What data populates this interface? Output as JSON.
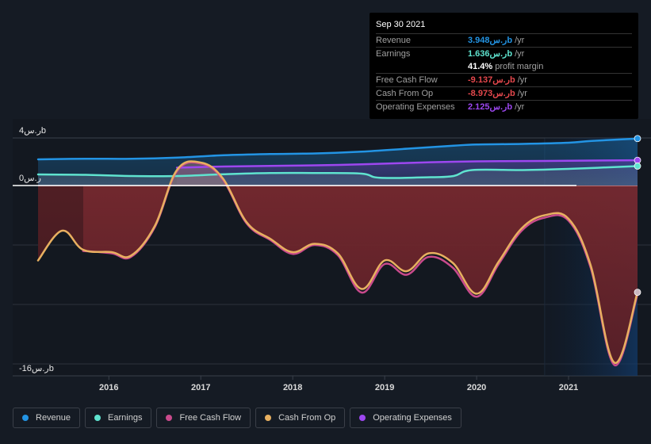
{
  "colors": {
    "revenue": "#2394e4",
    "earnings": "#5fe3cf",
    "fcf": "#c94a8c",
    "cfo": "#e8b060",
    "opex": "#9d47f0"
  },
  "tooltip": {
    "date": "Sep 30 2021",
    "rows": [
      {
        "label": "Revenue",
        "value": "3.948ر.سb",
        "unit": "/yr",
        "color": "#2394e4"
      },
      {
        "label": "Earnings",
        "value": "1.636ر.سb",
        "unit": "/yr",
        "color": "#5fe3cf"
      },
      {
        "label": "",
        "value": "41.4%",
        "unit": "profit margin",
        "color": "#ffffff"
      },
      {
        "label": "Free Cash Flow",
        "value": "-9.137ر.سb",
        "unit": "/yr",
        "color": "#e5484d"
      },
      {
        "label": "Cash From Op",
        "value": "-8.973ر.سb",
        "unit": "/yr",
        "color": "#e5484d"
      },
      {
        "label": "Operating Expenses",
        "value": "2.125ر.سb",
        "unit": "/yr",
        "color": "#9d47f0"
      }
    ]
  },
  "legend": [
    {
      "label": "Revenue",
      "color": "#2394e4"
    },
    {
      "label": "Earnings",
      "color": "#5fe3cf"
    },
    {
      "label": "Free Cash Flow",
      "color": "#c94a8c"
    },
    {
      "label": "Cash From Op",
      "color": "#e8b060"
    },
    {
      "label": "Operating Expenses",
      "color": "#9d47f0"
    }
  ],
  "chart_data": {
    "type": "line",
    "title": "",
    "xlabel": "",
    "ylabel": "",
    "unit": "ر.سb",
    "y_tick_labels": [
      {
        "value": 4,
        "label": "4ر.سb"
      },
      {
        "value": 0,
        "label": "0ر.س"
      },
      {
        "value": -16,
        "label": "-16ر.سb"
      }
    ],
    "ylim": [
      -16,
      4
    ],
    "gridlines": [
      4,
      0,
      -5,
      -10,
      -15
    ],
    "x_ticks": [
      2016,
      2017,
      2018,
      2019,
      2020,
      2021
    ],
    "xlim": [
      2015.23,
      2021.75
    ],
    "highlight_from": 2020.74,
    "grid": true,
    "legend_position": "bottom-left",
    "series": [
      {
        "name": "Revenue",
        "key": "revenue",
        "points": [
          [
            2015.23,
            2.2
          ],
          [
            2015.75,
            2.25
          ],
          [
            2016.25,
            2.25
          ],
          [
            2016.75,
            2.35
          ],
          [
            2017.25,
            2.55
          ],
          [
            2017.75,
            2.65
          ],
          [
            2018.25,
            2.7
          ],
          [
            2018.75,
            2.85
          ],
          [
            2019.25,
            3.1
          ],
          [
            2019.75,
            3.35
          ],
          [
            2020.0,
            3.45
          ],
          [
            2020.5,
            3.5
          ],
          [
            2021.0,
            3.6
          ],
          [
            2021.25,
            3.75
          ],
          [
            2021.75,
            3.948
          ]
        ]
      },
      {
        "name": "Earnings",
        "key": "earnings",
        "points": [
          [
            2015.23,
            0.93
          ],
          [
            2015.75,
            0.9
          ],
          [
            2016.25,
            0.8
          ],
          [
            2016.75,
            0.8
          ],
          [
            2017.25,
            0.95
          ],
          [
            2017.75,
            1.05
          ],
          [
            2018.25,
            1.05
          ],
          [
            2018.75,
            1.0
          ],
          [
            2018.95,
            0.65
          ],
          [
            2019.5,
            0.7
          ],
          [
            2019.75,
            0.8
          ],
          [
            2019.95,
            1.3
          ],
          [
            2020.5,
            1.3
          ],
          [
            2021.0,
            1.4
          ],
          [
            2021.75,
            1.636
          ]
        ]
      },
      {
        "name": "Free Cash Flow",
        "key": "fcf",
        "points": [
          [
            2015.72,
            -5.5
          ],
          [
            2016.03,
            -5.7
          ],
          [
            2016.24,
            -6.0
          ],
          [
            2016.5,
            -3.5
          ],
          [
            2016.74,
            1.2
          ],
          [
            2017.0,
            1.85
          ],
          [
            2017.24,
            0.5
          ],
          [
            2017.5,
            -3.2
          ],
          [
            2017.76,
            -4.6
          ],
          [
            2018.0,
            -5.75
          ],
          [
            2018.24,
            -5.0
          ],
          [
            2018.49,
            -5.85
          ],
          [
            2018.75,
            -9.0
          ],
          [
            2019.0,
            -6.6
          ],
          [
            2019.24,
            -7.5
          ],
          [
            2019.48,
            -6.0
          ],
          [
            2019.74,
            -6.9
          ],
          [
            2020.0,
            -9.35
          ],
          [
            2020.24,
            -6.6
          ],
          [
            2020.49,
            -3.8
          ],
          [
            2020.74,
            -2.7
          ],
          [
            2021.0,
            -2.95
          ],
          [
            2021.24,
            -6.9
          ],
          [
            2021.5,
            -15.1
          ],
          [
            2021.75,
            -9.137
          ]
        ]
      },
      {
        "name": "Cash From Op",
        "key": "cfo",
        "points": [
          [
            2015.23,
            -6.3
          ],
          [
            2015.49,
            -3.8
          ],
          [
            2015.72,
            -5.4
          ],
          [
            2016.03,
            -5.6
          ],
          [
            2016.24,
            -5.9
          ],
          [
            2016.5,
            -3.4
          ],
          [
            2016.74,
            1.3
          ],
          [
            2017.0,
            1.93
          ],
          [
            2017.24,
            0.6
          ],
          [
            2017.5,
            -3.1
          ],
          [
            2017.76,
            -4.5
          ],
          [
            2018.0,
            -5.6
          ],
          [
            2018.24,
            -4.9
          ],
          [
            2018.49,
            -5.7
          ],
          [
            2018.75,
            -8.7
          ],
          [
            2019.0,
            -6.3
          ],
          [
            2019.24,
            -7.2
          ],
          [
            2019.48,
            -5.7
          ],
          [
            2019.74,
            -6.5
          ],
          [
            2020.0,
            -9.1
          ],
          [
            2020.24,
            -6.4
          ],
          [
            2020.49,
            -3.6
          ],
          [
            2020.74,
            -2.5
          ],
          [
            2021.0,
            -2.8
          ],
          [
            2021.24,
            -6.7
          ],
          [
            2021.5,
            -14.9
          ],
          [
            2021.75,
            -8.973
          ]
        ]
      },
      {
        "name": "Operating Expenses",
        "key": "opex",
        "points": [
          [
            2016.74,
            1.5
          ],
          [
            2017.25,
            1.6
          ],
          [
            2017.75,
            1.65
          ],
          [
            2018.25,
            1.7
          ],
          [
            2018.75,
            1.78
          ],
          [
            2019.25,
            1.9
          ],
          [
            2019.75,
            2.0
          ],
          [
            2020.25,
            2.05
          ],
          [
            2020.75,
            2.07
          ],
          [
            2021.25,
            2.1
          ],
          [
            2021.75,
            2.125
          ]
        ]
      }
    ]
  }
}
